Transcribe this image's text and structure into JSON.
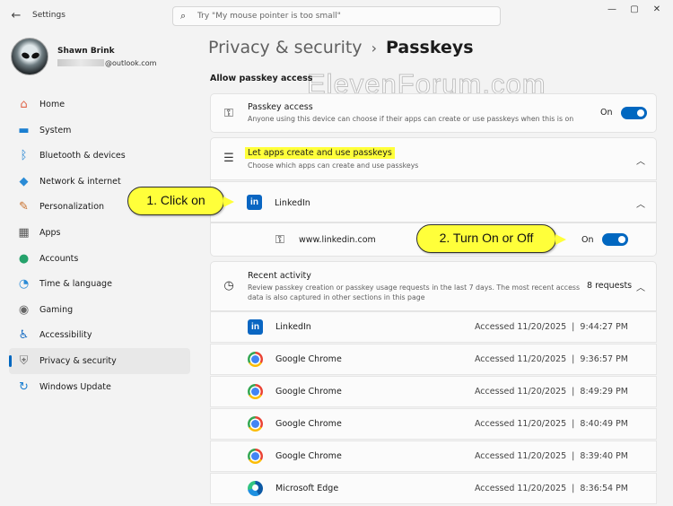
{
  "titlebar": {
    "back_glyph": "←",
    "title": "Settings",
    "search_placeholder": "Try \"My mouse pointer is too small\"",
    "minimize": "—",
    "maximize": "▢",
    "close": "✕"
  },
  "profile": {
    "name": "Shawn Brink",
    "email_domain": "@outlook.com"
  },
  "sidebar": {
    "items": [
      {
        "label": "Home",
        "icon": "home-icon",
        "glyph": "⌂",
        "color": "#e0654a"
      },
      {
        "label": "System",
        "icon": "monitor-icon",
        "glyph": "▬",
        "color": "#1b7fd1"
      },
      {
        "label": "Bluetooth & devices",
        "icon": "bluetooth-icon",
        "glyph": "ᛒ",
        "color": "#1b7fd1"
      },
      {
        "label": "Network & internet",
        "icon": "wifi-icon",
        "glyph": "◆",
        "color": "#2a8bd6"
      },
      {
        "label": "Personalization",
        "icon": "brush-icon",
        "glyph": "✎",
        "color": "#c96f2a"
      },
      {
        "label": "Apps",
        "icon": "apps-icon",
        "glyph": "▦",
        "color": "#555555"
      },
      {
        "label": "Accounts",
        "icon": "person-icon",
        "glyph": "●",
        "color": "#25a26b"
      },
      {
        "label": "Time & language",
        "icon": "globe-clock-icon",
        "glyph": "◔",
        "color": "#2a8bd6"
      },
      {
        "label": "Gaming",
        "icon": "controller-icon",
        "glyph": "◉",
        "color": "#666666"
      },
      {
        "label": "Accessibility",
        "icon": "accessibility-icon",
        "glyph": "♿",
        "color": "#1b6fc4"
      },
      {
        "label": "Privacy & security",
        "icon": "shield-icon",
        "glyph": "⛨",
        "color": "#777777"
      },
      {
        "label": "Windows Update",
        "icon": "update-icon",
        "glyph": "↻",
        "color": "#1b7fd1"
      }
    ],
    "selected_index": 10
  },
  "header": {
    "parent": "Privacy & security",
    "separator": "›",
    "current": "Passkeys",
    "watermark": "ElevenForum.com"
  },
  "section_label": "Allow passkey access",
  "passkey_access": {
    "title": "Passkey access",
    "desc": "Anyone using this device can choose if their apps can create or use passkeys when this is on",
    "state": "On"
  },
  "apps_section": {
    "title": "Let apps create and use passkeys",
    "desc": "Choose which apps can create and use passkeys"
  },
  "linkedin_app": {
    "name": "LinkedIn",
    "site": "www.linkedin.com",
    "state": "On",
    "logo_text": "in"
  },
  "recent_activity": {
    "title": "Recent activity",
    "desc_line1": "Review passkey creation or passkey usage requests in the last 7 days. The most recent access",
    "desc_line2": "data is also captured in other sections in this page",
    "count": "8 requests",
    "rows": [
      {
        "app": "LinkedIn",
        "icon": "linkedin",
        "time": "Accessed 11/20/2025  |  9:44:27 PM"
      },
      {
        "app": "Google Chrome",
        "icon": "chrome",
        "time": "Accessed 11/20/2025  |  9:36:57 PM"
      },
      {
        "app": "Google Chrome",
        "icon": "chrome",
        "time": "Accessed 11/20/2025  |  8:49:29 PM"
      },
      {
        "app": "Google Chrome",
        "icon": "chrome",
        "time": "Accessed 11/20/2025  |  8:40:49 PM"
      },
      {
        "app": "Google Chrome",
        "icon": "chrome",
        "time": "Accessed 11/20/2025  |  8:39:40 PM"
      },
      {
        "app": "Microsoft Edge",
        "icon": "edge",
        "time": "Accessed 11/20/2025  |  8:36:54 PM"
      }
    ]
  },
  "callouts": {
    "step1": "1. Click on",
    "step2": "2. Turn On or Off"
  },
  "colors": {
    "accent": "#0067c0",
    "callout": "#ffff3a",
    "linkedin": "#0a66c2"
  }
}
